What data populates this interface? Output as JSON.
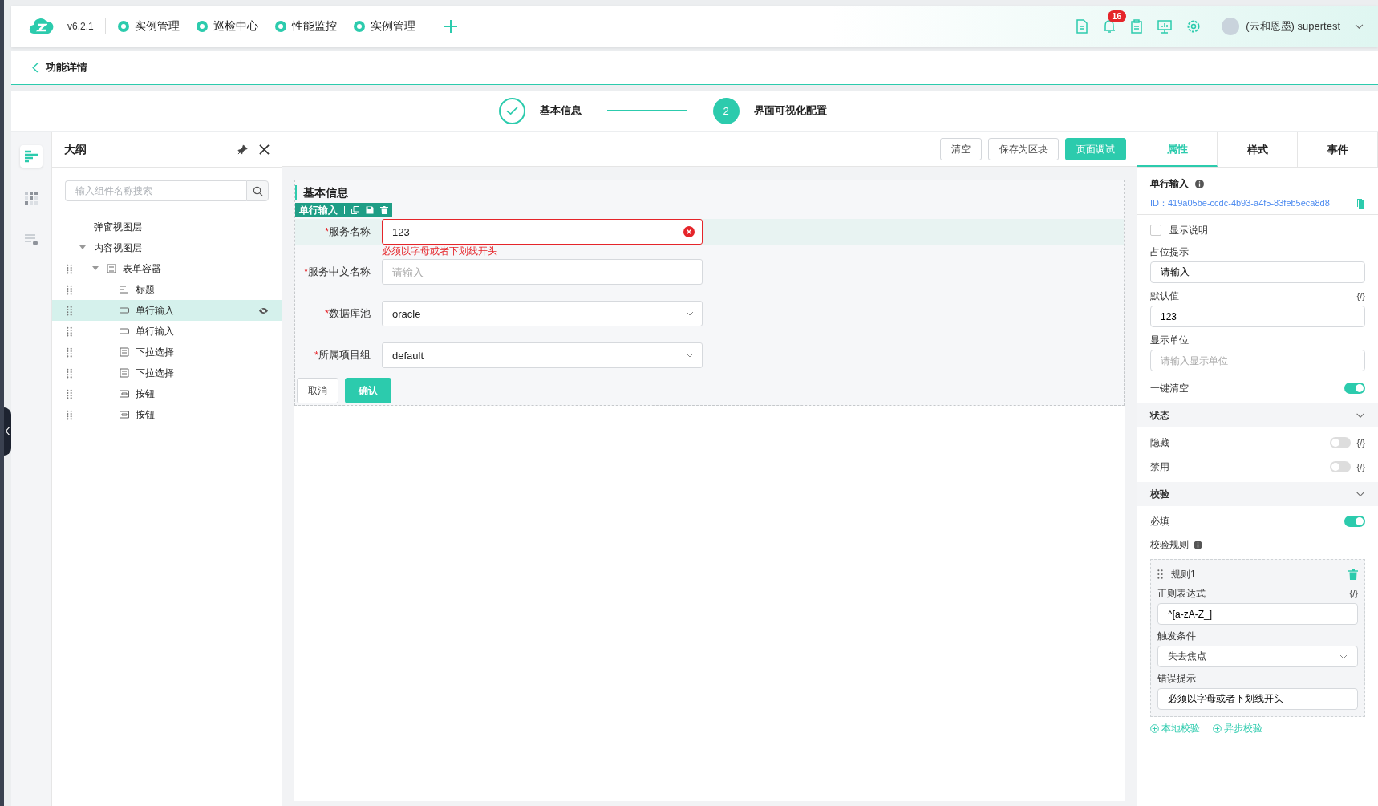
{
  "header": {
    "version": "v6.2.1",
    "nav": [
      {
        "label": "实例管理"
      },
      {
        "label": "巡检中心"
      },
      {
        "label": "性能监控"
      },
      {
        "label": "实例管理"
      }
    ],
    "notifications": "16",
    "user": "(云和恩墨) supertest"
  },
  "breadcrumb": {
    "title": "功能详情"
  },
  "steps": [
    {
      "label": "基本信息",
      "done": true
    },
    {
      "label": "界面可视化配置",
      "done": false,
      "number": "2"
    }
  ],
  "rail": [
    {
      "kind": "outline",
      "selected": true
    },
    {
      "kind": "components",
      "selected": false
    },
    {
      "kind": "settings",
      "selected": false
    }
  ],
  "outline": {
    "title": "大纲",
    "search_placeholder": "输入组件名称搜索",
    "tree": [
      {
        "label": "弹窗视图层",
        "kind": "layer",
        "selected": false
      },
      {
        "label": "内容视图层",
        "kind": "layer",
        "selected": false,
        "expanded": true,
        "children": [
          {
            "label": "表单容器",
            "kind": "form",
            "selected": false,
            "expanded": true,
            "children": [
              {
                "label": "标题",
                "kind": "title",
                "selected": false
              },
              {
                "label": "单行输入",
                "kind": "input",
                "selected": true,
                "hidden": true
              },
              {
                "label": "单行输入",
                "kind": "input",
                "selected": false
              },
              {
                "label": "下拉选择",
                "kind": "select",
                "selected": false
              },
              {
                "label": "下拉选择",
                "kind": "select",
                "selected": false
              },
              {
                "label": "按钮",
                "kind": "button",
                "selected": false
              },
              {
                "label": "按钮",
                "kind": "button",
                "selected": false
              }
            ]
          }
        ]
      }
    ]
  },
  "toolbar": [
    {
      "label": "清空",
      "kind": "default"
    },
    {
      "label": "保存为区块",
      "kind": "default"
    },
    {
      "label": "页面调试",
      "kind": "primary"
    }
  ],
  "canvas": {
    "section_title": "基本信息",
    "selection_label": "单行输入",
    "required_mark": "*",
    "fields": [
      {
        "label": "服务名称",
        "required": true,
        "kind": "input",
        "value": "123",
        "error": "必须以字母或者下划线开头",
        "selected": true
      },
      {
        "label": "服务中文名称",
        "required": true,
        "kind": "input",
        "placeholder": "请输入",
        "selected": false
      },
      {
        "label": "数据库池",
        "required": true,
        "kind": "select",
        "value": "oracle",
        "selected": false
      },
      {
        "label": "所属项目组",
        "required": true,
        "kind": "select",
        "value": "default",
        "selected": false
      }
    ],
    "actions": [
      {
        "label": "取消",
        "kind": "default"
      },
      {
        "label": "确认",
        "kind": "primary"
      }
    ]
  },
  "inspector": {
    "tabs": [
      {
        "label": "属性",
        "selected": true
      },
      {
        "label": "样式",
        "selected": false
      },
      {
        "label": "事件",
        "selected": false
      }
    ],
    "component_title": "单行输入",
    "component_id": "ID：419a05be-ccdc-4b93-a4f5-83feb5eca8d8",
    "properties": [
      {
        "kind": "checkbox",
        "label": "显示说明",
        "checked": false
      },
      {
        "kind": "input",
        "label": "占位提示",
        "value": "请输入"
      },
      {
        "kind": "input",
        "label": "默认值",
        "value": "123",
        "binding": "{/}"
      },
      {
        "kind": "input",
        "label": "显示单位",
        "placeholder": "请输入显示单位"
      },
      {
        "kind": "switch",
        "label": "一键清空",
        "on": true
      },
      {
        "kind": "section",
        "label": "状态",
        "expanded": true
      },
      {
        "kind": "switch",
        "label": "隐藏",
        "on": false,
        "binding": "{/}"
      },
      {
        "kind": "switch",
        "label": "禁用",
        "on": false,
        "binding": "{/}"
      },
      {
        "kind": "section",
        "label": "校验",
        "expanded": true
      },
      {
        "kind": "switch",
        "label": "必填",
        "on": true
      },
      {
        "kind": "heading",
        "label": "校验规则"
      }
    ],
    "rules": [
      {
        "name": "规则1",
        "fields": [
          {
            "kind": "input",
            "label": "正则表达式",
            "binding": "{/}",
            "value": "^[a-zA-Z_]"
          },
          {
            "kind": "select",
            "label": "触发条件",
            "value": "失去焦点"
          },
          {
            "kind": "input",
            "label": "错误提示",
            "value": "必须以字母或者下划线开头"
          }
        ]
      }
    ],
    "rule_links": [
      {
        "label": "本地校验"
      },
      {
        "label": "异步校验"
      }
    ]
  }
}
